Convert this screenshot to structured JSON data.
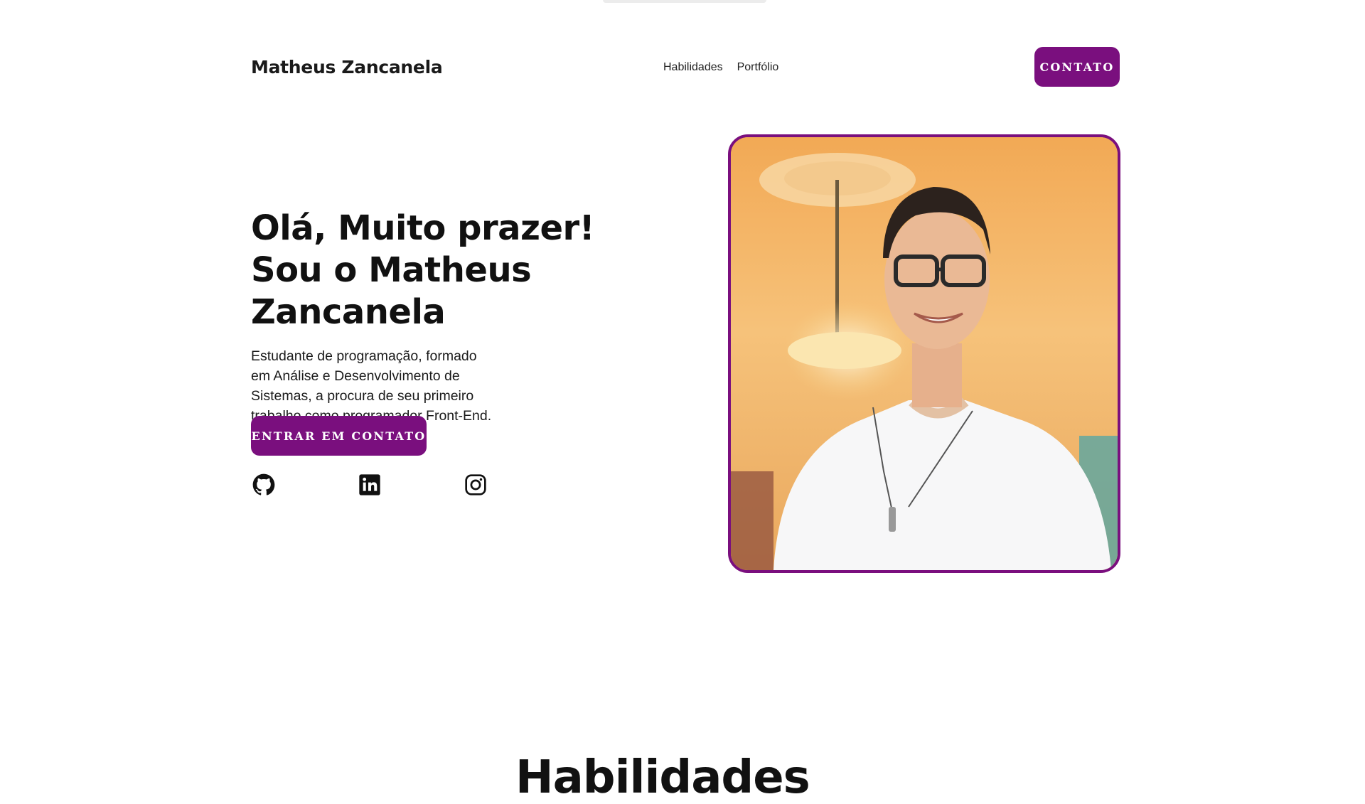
{
  "header": {
    "brand": "Matheus Zancanela",
    "nav": [
      {
        "label": "Habilidades"
      },
      {
        "label": "Portfólio"
      }
    ],
    "contact_button": "Contato"
  },
  "hero": {
    "title_line1": "Olá, Muito prazer!",
    "title_line2": "Sou o Matheus Zancanela",
    "description": "Estudante de programação, formado em Análise e Desenvolvimento de Sistemas, a procura de seu primeiro trabalho como programador Front-End.",
    "cta_button": "Entrar em contato",
    "socials": [
      {
        "icon": "github-icon"
      },
      {
        "icon": "linkedin-icon"
      },
      {
        "icon": "instagram-icon"
      }
    ]
  },
  "next_section": {
    "title": "Habilidades"
  },
  "colors": {
    "accent": "#7a0f7e",
    "text": "#111111",
    "background": "#ffffff"
  }
}
